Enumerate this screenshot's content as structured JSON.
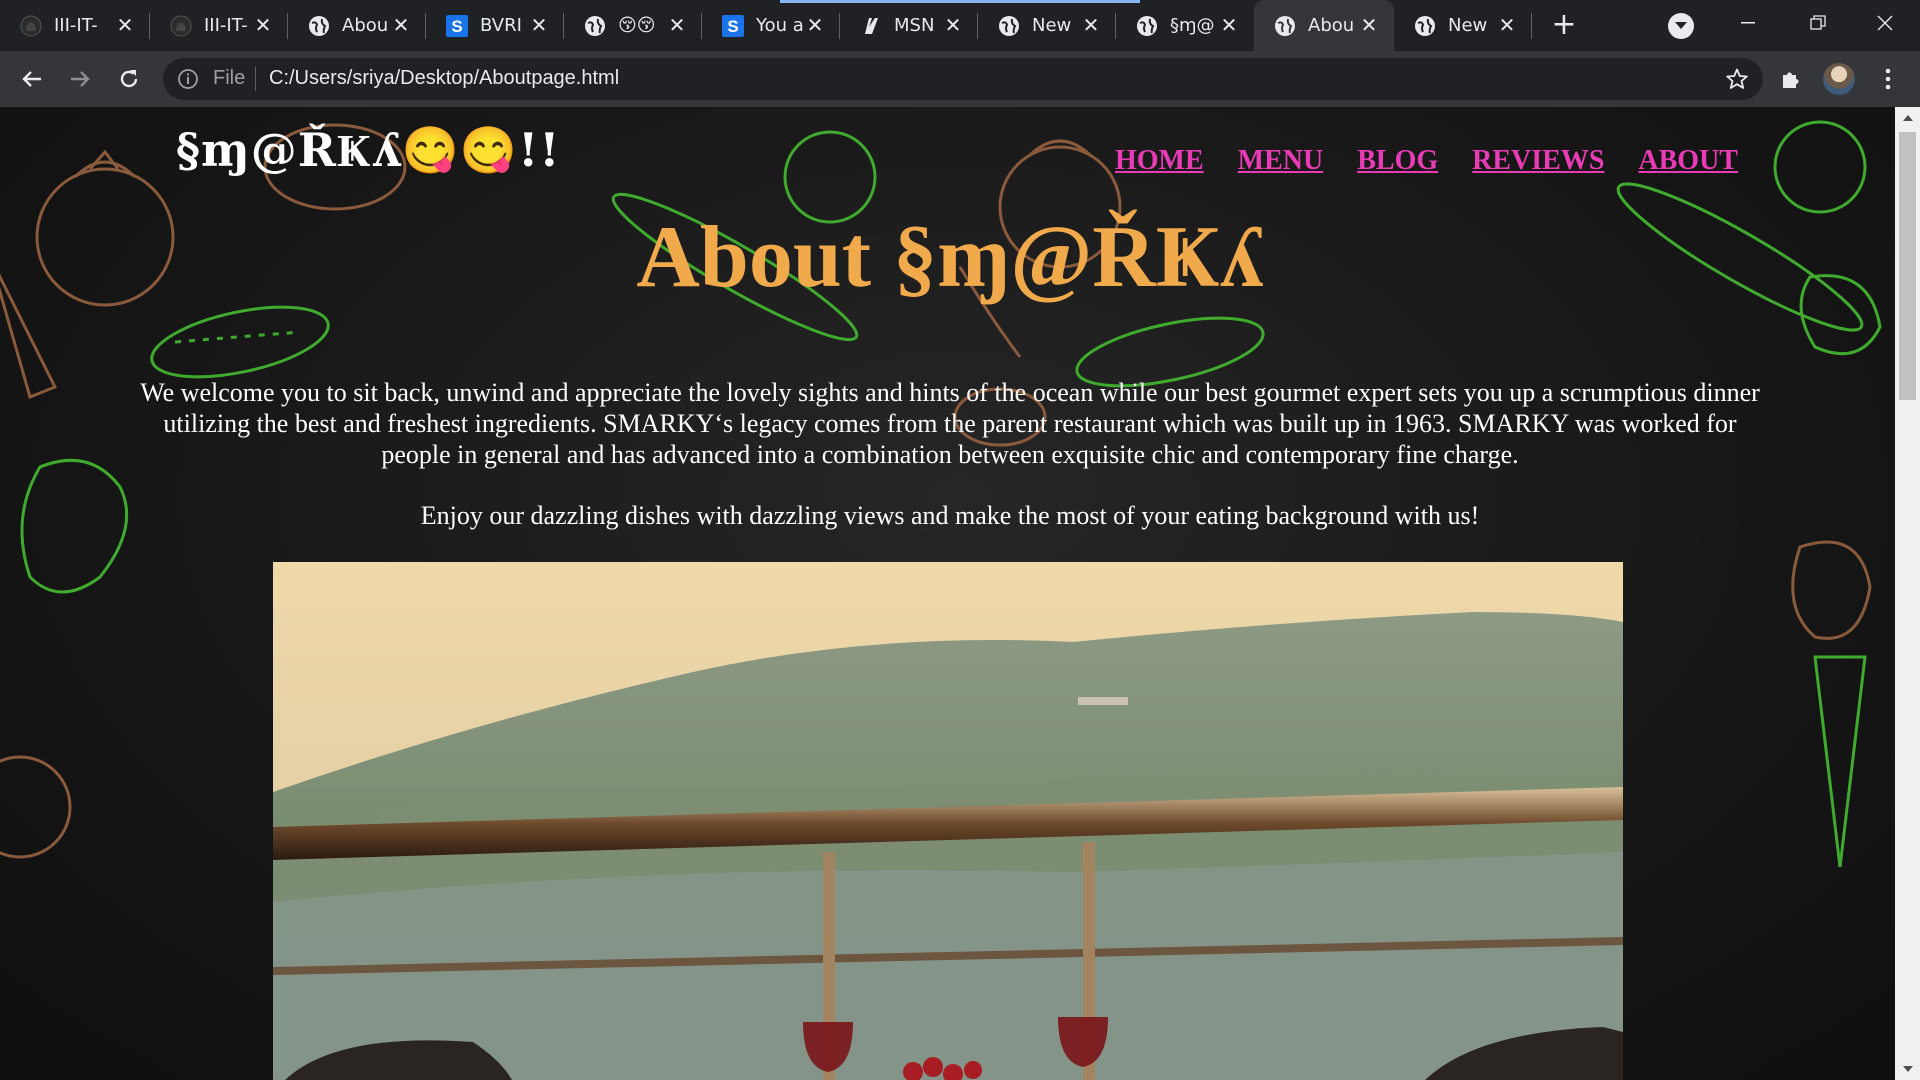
{
  "browser": {
    "tabs": [
      {
        "title": "III-IT-",
        "icon": "github-icon"
      },
      {
        "title": "III-IT-",
        "icon": "github-icon"
      },
      {
        "title": "Abou",
        "icon": "globe-icon"
      },
      {
        "title": "BVRI",
        "icon": "s-brand-icon"
      },
      {
        "title": "😚😚",
        "icon": "globe-icon"
      },
      {
        "title": "You a",
        "icon": "s-brand-icon"
      },
      {
        "title": "MSN",
        "icon": "msn-icon"
      },
      {
        "title": "New",
        "icon": "globe-icon"
      },
      {
        "title": "§ɱ@",
        "icon": "globe-icon"
      },
      {
        "title": "Abou",
        "icon": "globe-icon",
        "active": true
      },
      {
        "title": "New",
        "icon": "globe-icon"
      }
    ],
    "omnibox": {
      "scheme_label": "File",
      "url": "C:/Users/sriya/Desktop/Aboutpage.html"
    },
    "accent_color": "#8ab4f8"
  },
  "page": {
    "brand": "§ɱ@ŘҜʎ😋😋!!",
    "nav": [
      "HOME",
      "MENU",
      "BLOG",
      "REVIEWS",
      "ABOUT"
    ],
    "heading": "About §ɱ@ŘҜʎ",
    "paragraph": "We welcome you to sit back, unwind and appreciate the lovely sights and hints of the ocean while our best gourmet expert sets you up a scrumptious dinner utilizing the best and freshest ingredients. SMARKY‘s legacy comes from the parent restaurant which was built up in 1963. SMARKY was worked for people in general and has advanced into a combination between exquisite chic and contemporary fine charge.",
    "tagline": "Enjoy our dazzling dishes with dazzling views and make the most of your eating background with us!",
    "colors": {
      "nav_link": "#e83bb5",
      "heading": "#f0a94b",
      "background": "#1a1a1a"
    }
  }
}
